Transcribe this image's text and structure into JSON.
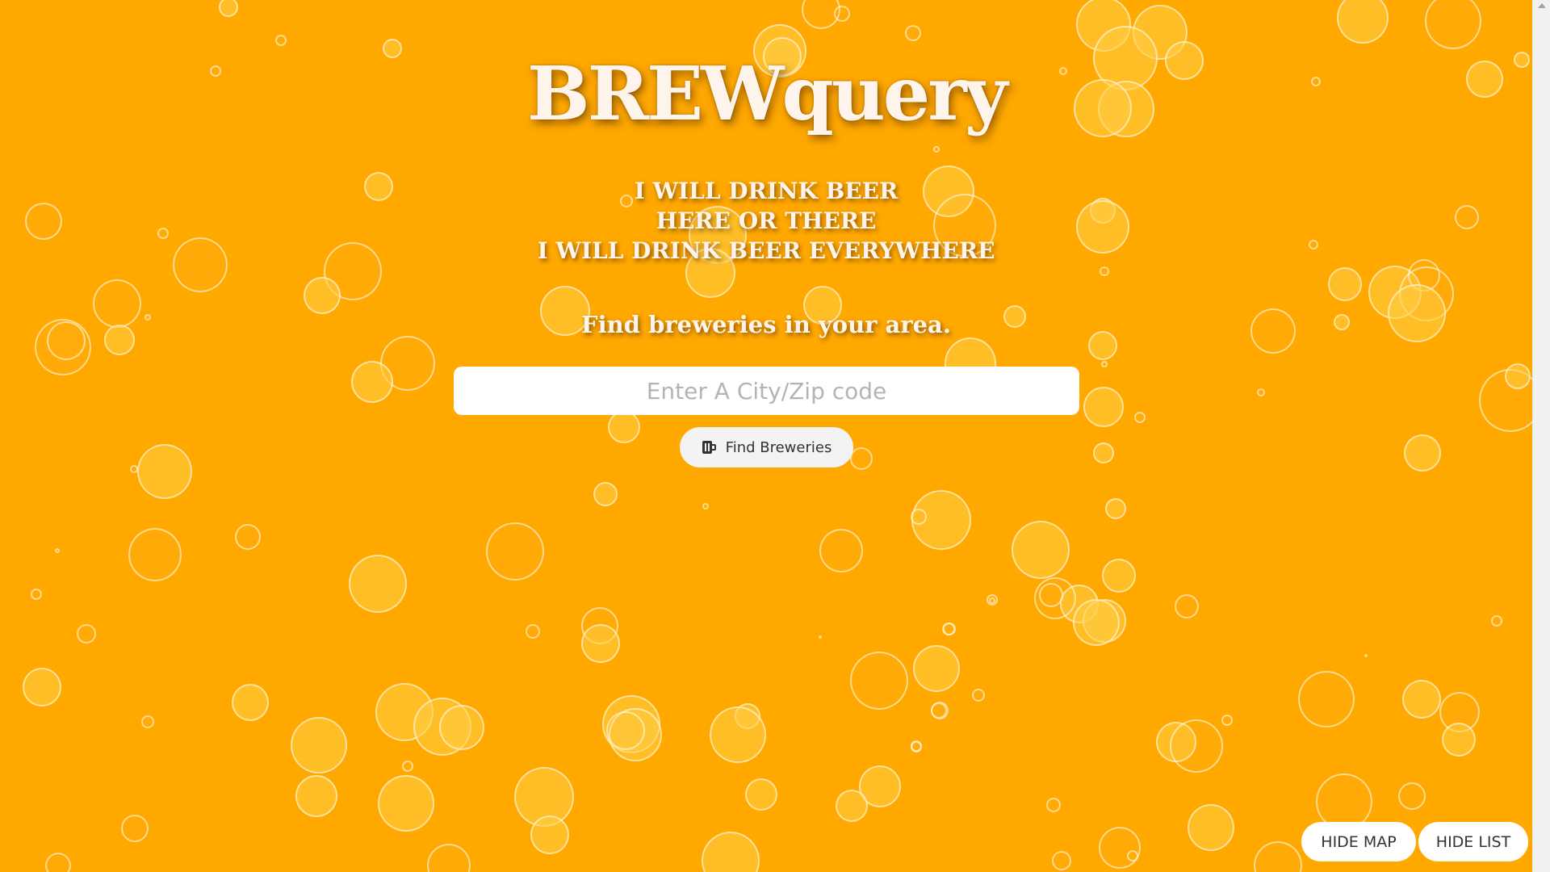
{
  "app": {
    "title": "BREWquery",
    "tagline": [
      "I WILL DRINK BEER",
      "HERE OR THERE",
      "I WILL DRINK BEER EVERYWHERE"
    ],
    "subtitle": "Find breweries in your area."
  },
  "search": {
    "placeholder": "Enter A City/Zip code",
    "value": "",
    "button_label": "Find Breweries",
    "button_icon": "beer-mug-icon"
  },
  "toggles": {
    "hide_map_label": "HIDE MAP",
    "hide_list_label": "HIDE LIST"
  },
  "colors": {
    "background": "#FFA800",
    "text": "#FFF4EC",
    "button_bg": "#F3F3F3"
  }
}
